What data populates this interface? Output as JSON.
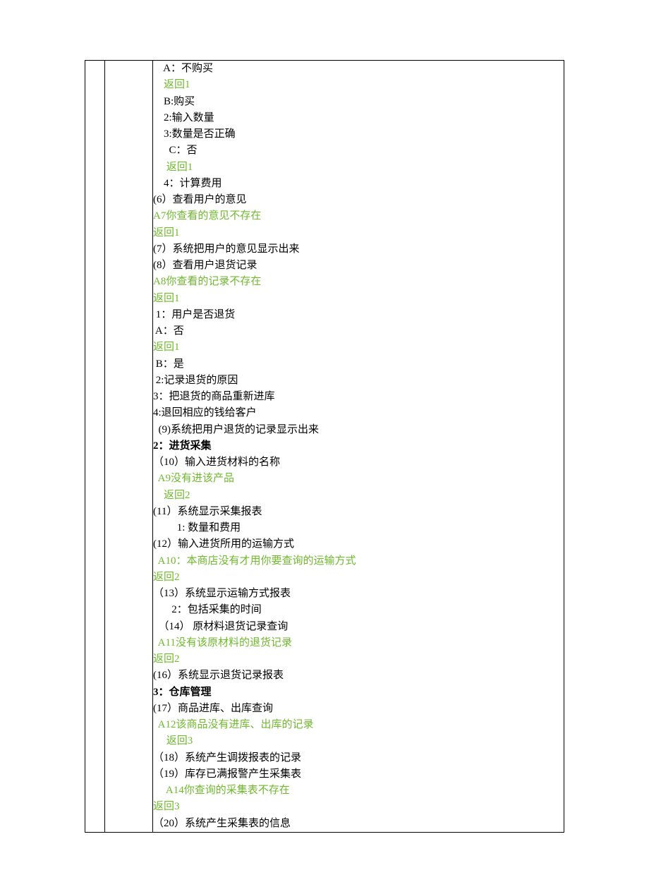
{
  "lines": [
    {
      "text": "    A：不购买",
      "cls": ""
    },
    {
      "text": "    返回1",
      "cls": "green"
    },
    {
      "text": "    B:购买",
      "cls": ""
    },
    {
      "text": "    2:输入数量",
      "cls": ""
    },
    {
      "text": "    3:数量是否正确",
      "cls": ""
    },
    {
      "text": "      C：否",
      "cls": ""
    },
    {
      "text": "     返回1",
      "cls": "green"
    },
    {
      "text": "    4：计算费用",
      "cls": ""
    },
    {
      "text": "(6）查看用户的意见",
      "cls": ""
    },
    {
      "text": "A7你查看的意见不存在",
      "cls": "green"
    },
    {
      "text": "返回1",
      "cls": "green"
    },
    {
      "text": "(7）系统把用户的意见显示出来",
      "cls": ""
    },
    {
      "text": "(8）查看用户退货记录",
      "cls": ""
    },
    {
      "text": "A8你查看的记录不存在",
      "cls": "green"
    },
    {
      "text": "返回1",
      "cls": "green"
    },
    {
      "text": " 1：用户是否退货",
      "cls": ""
    },
    {
      "text": " A：否",
      "cls": ""
    },
    {
      "text": "返回1",
      "cls": "green"
    },
    {
      "text": " B：是",
      "cls": ""
    },
    {
      "text": " 2:记录退货的原因",
      "cls": ""
    },
    {
      "text": "3：把退货的商品重新进库",
      "cls": ""
    },
    {
      "text": "4:退回相应的钱给客户",
      "cls": ""
    },
    {
      "text": "  (9)系统把用户退货的记录显示出来",
      "cls": ""
    },
    {
      "text": "2：进货采集",
      "cls": "bold"
    },
    {
      "text": "（10）输入进货材料的名称",
      "cls": ""
    },
    {
      "text": "  A9没有进该产品",
      "cls": "green"
    },
    {
      "text": "    返回2",
      "cls": "green"
    },
    {
      "text": "(11）系统显示采集报表",
      "cls": ""
    },
    {
      "text": "         1: 数量和费用",
      "cls": ""
    },
    {
      "text": "(12）输入进货所用的运输方式",
      "cls": ""
    },
    {
      "text": "  A10：本商店没有才用你要查询的运输方式",
      "cls": "green"
    },
    {
      "text": "返回2",
      "cls": "green"
    },
    {
      "text": "（13）系统显示运输方式报表",
      "cls": ""
    },
    {
      "text": "       2：包括采集的时间",
      "cls": ""
    },
    {
      "text": "  （14） 原材料退货记录查询",
      "cls": ""
    },
    {
      "text": "  A11没有该原材料的退货记录",
      "cls": "green"
    },
    {
      "text": "返回2",
      "cls": "green"
    },
    {
      "text": "(16）系统显示退货记录报表",
      "cls": ""
    },
    {
      "text": "3：仓库管理",
      "cls": "bold"
    },
    {
      "text": "(17）商品进库、出库查询",
      "cls": ""
    },
    {
      "text": "  A12该商品没有进库、出库的记录",
      "cls": "green"
    },
    {
      "text": "     返回3",
      "cls": "green"
    },
    {
      "text": "（18）系统产生调拨报表的记录",
      "cls": ""
    },
    {
      "text": "（19）库存已满报警产生采集表",
      "cls": ""
    },
    {
      "text": "     A14你查询的采集表不存在",
      "cls": "green"
    },
    {
      "text": "返回3",
      "cls": "green"
    },
    {
      "text": "（20）系统产生采集表的信息",
      "cls": ""
    }
  ]
}
